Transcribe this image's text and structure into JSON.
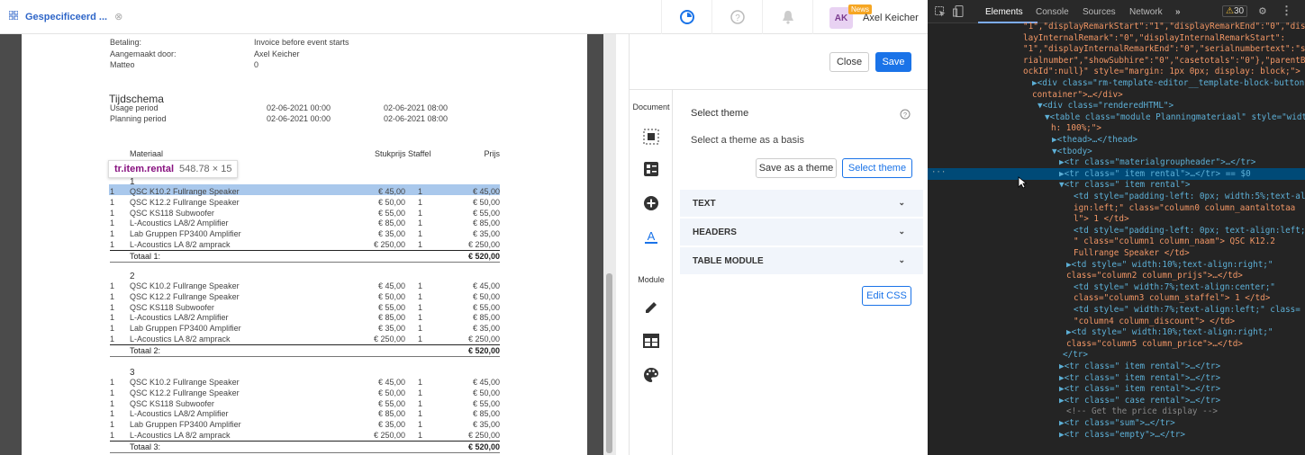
{
  "topbar": {
    "title": "Gespecificeerd ...",
    "user_initials": "AK",
    "news_badge": "News",
    "user_name": "Axel Keicher"
  },
  "document": {
    "meta": [
      {
        "label": "Betaling:",
        "value": "Invoice before event starts"
      },
      {
        "label": "Aangemaakt door:",
        "value": "Axel Keicher"
      },
      {
        "label": "Matteo",
        "value": "0"
      }
    ],
    "schedule_title": "Tijdschema",
    "schedule": [
      {
        "label": "Usage period",
        "start": "02-06-2021 00:00",
        "end": "02-06-2021 08:00"
      },
      {
        "label": "Planning period",
        "start": "02-06-2021 00:00",
        "end": "02-06-2021 08:00"
      }
    ],
    "columns": {
      "material": "Materiaal",
      "unit_price": "Stukprijs",
      "staffel": "Staffel",
      "price": "Prijs"
    },
    "groups": [
      {
        "number": "1",
        "total_label": "Totaal 1:",
        "total": "€ 520,00",
        "rows": [
          {
            "qty": "1",
            "name": "QSC K10.2 Fullrange Speaker",
            "unit": "€ 45,00",
            "staffel": "1",
            "price": "€ 45,00"
          },
          {
            "qty": "1",
            "name": "QSC K12.2 Fullrange Speaker",
            "unit": "€ 50,00",
            "staffel": "1",
            "price": "€ 50,00"
          },
          {
            "qty": "1",
            "name": "QSC KS118 Subwoofer",
            "unit": "€ 55,00",
            "staffel": "1",
            "price": "€ 55,00"
          },
          {
            "qty": "1",
            "name": "L-Acoustics LA8/2 Amplifier",
            "unit": "€ 85,00",
            "staffel": "1",
            "price": "€ 85,00"
          },
          {
            "qty": "1",
            "name": "Lab Gruppen FP3400 Amplifier",
            "unit": "€ 35,00",
            "staffel": "1",
            "price": "€ 35,00"
          },
          {
            "qty": "1",
            "name": "L-Acoustics LA 8/2 amprack",
            "unit": "€ 250,00",
            "staffel": "1",
            "price": "€ 250,00"
          }
        ]
      },
      {
        "number": "2",
        "total_label": "Totaal 2:",
        "total": "€ 520,00",
        "rows": [
          {
            "qty": "1",
            "name": "QSC K10.2 Fullrange Speaker",
            "unit": "€ 45,00",
            "staffel": "1",
            "price": "€ 45,00"
          },
          {
            "qty": "1",
            "name": "QSC K12.2 Fullrange Speaker",
            "unit": "€ 50,00",
            "staffel": "1",
            "price": "€ 50,00"
          },
          {
            "qty": "1",
            "name": "QSC KS118 Subwoofer",
            "unit": "€ 55,00",
            "staffel": "1",
            "price": "€ 55,00"
          },
          {
            "qty": "1",
            "name": "L-Acoustics LA8/2 Amplifier",
            "unit": "€ 85,00",
            "staffel": "1",
            "price": "€ 85,00"
          },
          {
            "qty": "1",
            "name": "Lab Gruppen FP3400 Amplifier",
            "unit": "€ 35,00",
            "staffel": "1",
            "price": "€ 35,00"
          },
          {
            "qty": "1",
            "name": "L-Acoustics LA 8/2 amprack",
            "unit": "€ 250,00",
            "staffel": "1",
            "price": "€ 250,00"
          }
        ]
      },
      {
        "number": "3",
        "total_label": "Totaal 3:",
        "total": "€ 520,00",
        "rows": [
          {
            "qty": "1",
            "name": "QSC K10.2 Fullrange Speaker",
            "unit": "€ 45,00",
            "staffel": "1",
            "price": "€ 45,00"
          },
          {
            "qty": "1",
            "name": "QSC K12.2 Fullrange Speaker",
            "unit": "€ 50,00",
            "staffel": "1",
            "price": "€ 50,00"
          },
          {
            "qty": "1",
            "name": "QSC KS118 Subwoofer",
            "unit": "€ 55,00",
            "staffel": "1",
            "price": "€ 55,00"
          },
          {
            "qty": "1",
            "name": "L-Acoustics LA8/2 Amplifier",
            "unit": "€ 85,00",
            "staffel": "1",
            "price": "€ 85,00"
          },
          {
            "qty": "1",
            "name": "Lab Gruppen FP3400 Amplifier",
            "unit": "€ 35,00",
            "staffel": "1",
            "price": "€ 35,00"
          },
          {
            "qty": "1",
            "name": "L-Acoustics LA 8/2 amprack",
            "unit": "€ 250,00",
            "staffel": "1",
            "price": "€ 250,00"
          }
        ]
      }
    ]
  },
  "tooltip": {
    "selector": "tr.item.rental",
    "size": "548.78 × 15"
  },
  "editor": {
    "close_label": "Close",
    "save_label": "Save",
    "side_document_label": "Document",
    "side_module_label": "Module",
    "theme_title": "Select theme",
    "theme_subtitle": "Select a theme as a basis",
    "save_as_theme_label": "Save as a theme",
    "select_theme_label": "Select theme",
    "sections": [
      "TEXT",
      "HEADERS",
      "TABLE MODULE"
    ],
    "edit_css_label": "Edit CSS"
  },
  "devtools": {
    "tabs": [
      "Elements",
      "Console",
      "Sources",
      "Network"
    ],
    "more_tabs": "»",
    "warning_count": "30",
    "lines": [
      {
        "text": "\"1\",\"displayRemarkStart\":\"1\",\"displayRemarkEnd\":\"0\",\"disp"
      },
      {
        "text": "layInternalRemark\":\"0\",\"displayInternalRemarkStart\":"
      },
      {
        "text": "\"1\",\"displayInternalRemarkEnd\":\"0\",\"serialnumbertext\":\"se"
      },
      {
        "text": "rialnumber\",\"showSubhire\":\"0\",\"casetotals\":\"0\"},\"parentBl"
      },
      {
        "text": "ockId\":null}\" style=\"margin: 1px 0px; display: block;\">"
      },
      {
        "text": "▶<div class=\"rm-template-editor__template-block-button-"
      },
      {
        "text": "container\">…</div>"
      },
      {
        "text": "▼<div class=\"renderedHTML\">"
      },
      {
        "text": "▼<table class=\"module Planningmateriaal\" style=\"widt"
      },
      {
        "text": "h: 100%;\">"
      },
      {
        "text": "▶<thead>…</thead>"
      },
      {
        "text": "▼<tbody>"
      },
      {
        "text": "▶<tr class=\"materialgroupheader\">…</tr>"
      },
      {
        "text": "▶<tr class=\" item rental\">…</tr> == $0"
      },
      {
        "text": "▼<tr class=\" item rental\">"
      },
      {
        "text": "<td style=\"padding-left: 0px; width:5%;text-al"
      },
      {
        "text": "ign:left;\" class=\"column0 column_aantaltotaa"
      },
      {
        "text": "l\"> 1 </td>"
      },
      {
        "text": "<td style=\"padding-left: 0px; text-align:left;"
      },
      {
        "text": "\" class=\"column1 column_naam\"> QSC K12.2"
      },
      {
        "text": "Fullrange Speaker </td>"
      },
      {
        "text": "▶<td style=\" width:10%;text-align:right;\""
      },
      {
        "text": "class=\"column2 column_prijs\">…</td>"
      },
      {
        "text": "<td style=\" width:7%;text-align:center;\""
      },
      {
        "text": "class=\"column3 column_staffel\"> 1 </td>"
      },
      {
        "text": "<td style=\" width:7%;text-align:left;\" class="
      },
      {
        "text": "\"column4 column_discount\"> </td>"
      },
      {
        "text": "▶<td style=\" width:10%;text-align:right;\""
      },
      {
        "text": "class=\"column5 column_price\">…</td>"
      },
      {
        "text": "</tr>"
      },
      {
        "text": "▶<tr class=\" item rental\">…</tr>"
      },
      {
        "text": "▶<tr class=\" item rental\">…</tr>"
      },
      {
        "text": "▶<tr class=\" item rental\">…</tr>"
      },
      {
        "text": "▶<tr class=\" case rental\">…</tr>"
      },
      {
        "text": "<!-- Get the price display -->"
      },
      {
        "text": "▶<tr class=\"sum\">…</tr>"
      },
      {
        "text": "▶<tr class=\"empty\">…</tr>"
      }
    ]
  }
}
